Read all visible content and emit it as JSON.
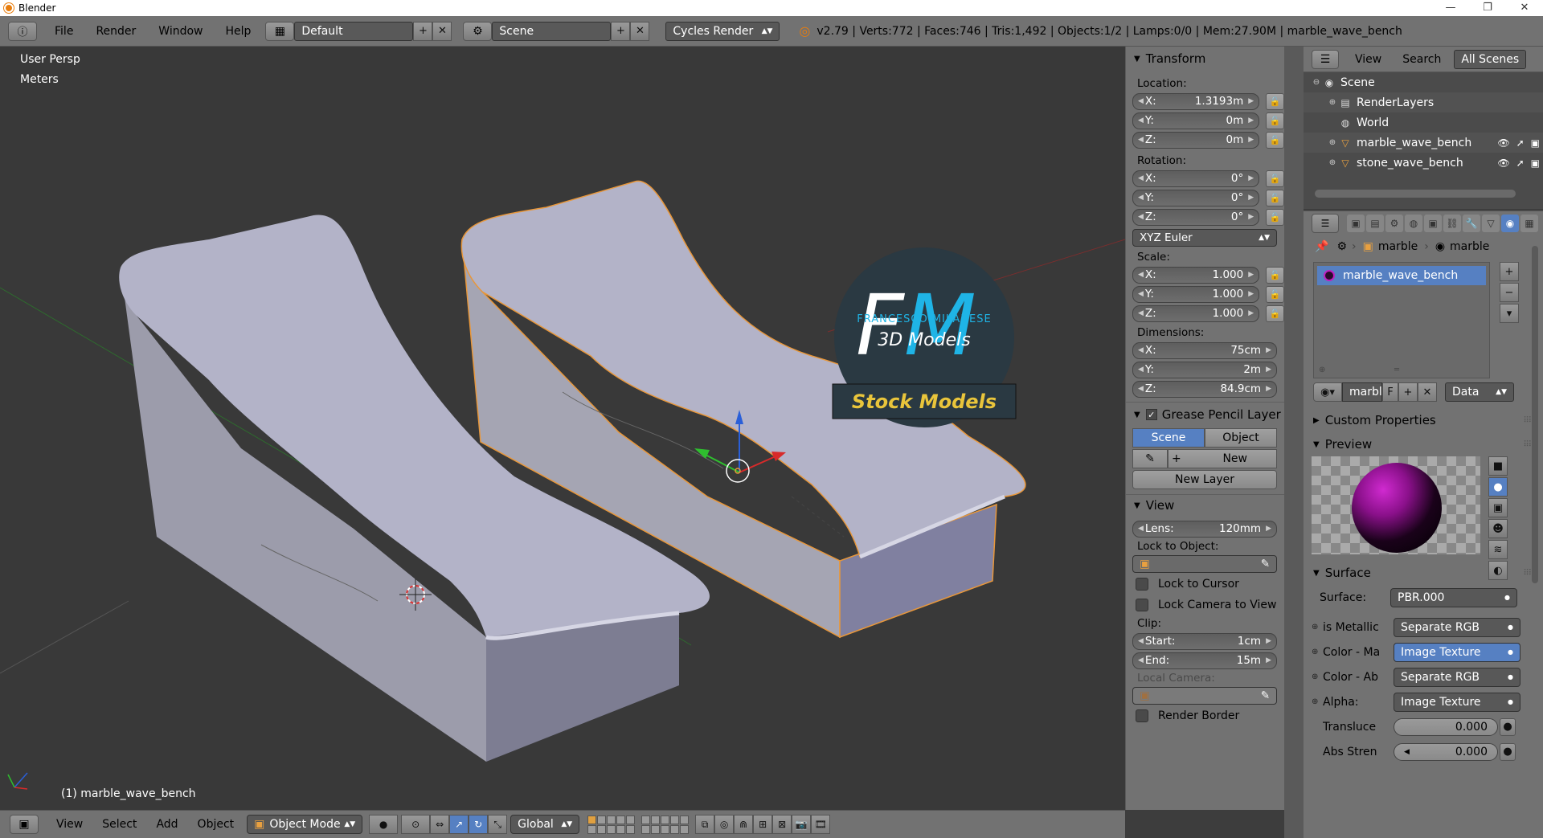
{
  "window": {
    "title": "Blender",
    "controls": [
      "—",
      "❐",
      "✕"
    ]
  },
  "info_header": {
    "menus": [
      "File",
      "Render",
      "Window",
      "Help"
    ],
    "screen_layout": "Default",
    "scene": "Scene",
    "render_engine": "Cycles Render",
    "stats": "v2.79 | Verts:772 | Faces:746 | Tris:1,492 | Objects:1/2 | Lamps:0/0 | Mem:27.90M | marble_wave_bench"
  },
  "viewport": {
    "view_name": "User Persp",
    "units": "Meters",
    "active_object_label": "(1) marble_wave_bench",
    "logo": {
      "letters_f": "F",
      "letters_m": "M",
      "author": "FRANCESCO MILANESE",
      "subtitle": "3D Models",
      "banner": "Stock Models"
    },
    "colors": {
      "background": "#393939",
      "bench_top": "#b3b3c8",
      "bench_side": "#9c9cab",
      "bench_base": "#7d7d92",
      "selection_outline": "#e8973a",
      "logo_cyan": "#1fb4e6",
      "banner_text": "#e9c53b"
    }
  },
  "npanel": {
    "transform": {
      "title": "Transform",
      "location_label": "Location:",
      "location": [
        {
          "axis": "X:",
          "value": "1.3193m"
        },
        {
          "axis": "Y:",
          "value": "0m"
        },
        {
          "axis": "Z:",
          "value": "0m"
        }
      ],
      "rotation_label": "Rotation:",
      "rotation": [
        {
          "axis": "X:",
          "value": "0°"
        },
        {
          "axis": "Y:",
          "value": "0°"
        },
        {
          "axis": "Z:",
          "value": "0°"
        }
      ],
      "rotation_mode": "XYZ Euler",
      "scale_label": "Scale:",
      "scale": [
        {
          "axis": "X:",
          "value": "1.000"
        },
        {
          "axis": "Y:",
          "value": "1.000"
        },
        {
          "axis": "Z:",
          "value": "1.000"
        }
      ],
      "dimensions_label": "Dimensions:",
      "dimensions": [
        {
          "axis": "X:",
          "value": "75cm"
        },
        {
          "axis": "Y:",
          "value": "2m"
        },
        {
          "axis": "Z:",
          "value": "84.9cm"
        }
      ]
    },
    "grease_pencil": {
      "title": "Grease Pencil Layer",
      "scene_btn": "Scene",
      "object_btn": "Object",
      "new_btn": "New",
      "new_layer_btn": "New Layer"
    },
    "view": {
      "title": "View",
      "lens_label": "Lens:",
      "lens_value": "120mm",
      "lock_object_label": "Lock to Object:",
      "lock_cursor": "Lock to Cursor",
      "lock_camera": "Lock Camera to View",
      "clip_label": "Clip:",
      "clip_start_label": "Start:",
      "clip_start": "1cm",
      "clip_end_label": "End:",
      "clip_end": "15m",
      "local_camera_label": "Local Camera:",
      "render_border": "Render Border"
    }
  },
  "outliner": {
    "header": {
      "view": "View",
      "search": "Search",
      "scope": "All Scenes"
    },
    "items": [
      {
        "label": "Scene",
        "icon": "scene-icon",
        "glyph": "◉"
      },
      {
        "label": "RenderLayers",
        "icon": "renderlayers-icon",
        "glyph": "▤"
      },
      {
        "label": "World",
        "icon": "world-icon",
        "glyph": "◍"
      },
      {
        "label": "marble_wave_bench",
        "icon": "mesh-icon",
        "glyph": "▽"
      },
      {
        "label": "stone_wave_bench",
        "icon": "mesh-icon",
        "glyph": "▽"
      }
    ]
  },
  "properties": {
    "breadcrumb": {
      "object": "marble",
      "material": "marble"
    },
    "material_slot": "marble_wave_bench",
    "datablock_name": "marbl",
    "fake_user": "F",
    "link_mode": "Data",
    "sections": {
      "custom_properties": "Custom Properties",
      "preview": "Preview",
      "surface": "Surface"
    },
    "surface": {
      "surface_label": "Surface:",
      "surface_value": "PBR.000",
      "inputs": [
        {
          "label": "is Metallic",
          "value": "Separate RGB",
          "highlight": false
        },
        {
          "label": "Color - Ma",
          "value": "Image Texture",
          "highlight": true
        },
        {
          "label": "Color - Ab",
          "value": "Separate RGB",
          "highlight": false
        },
        {
          "label": "Alpha:",
          "value": "Image Texture",
          "highlight": false
        }
      ],
      "sliders": [
        {
          "label": "Transluce",
          "value": "0.000"
        },
        {
          "label": "Abs Stren",
          "value": "0.000"
        }
      ]
    }
  },
  "viewport_header": {
    "menus": [
      "View",
      "Select",
      "Add",
      "Object"
    ],
    "mode": "Object Mode",
    "orientation": "Global"
  }
}
